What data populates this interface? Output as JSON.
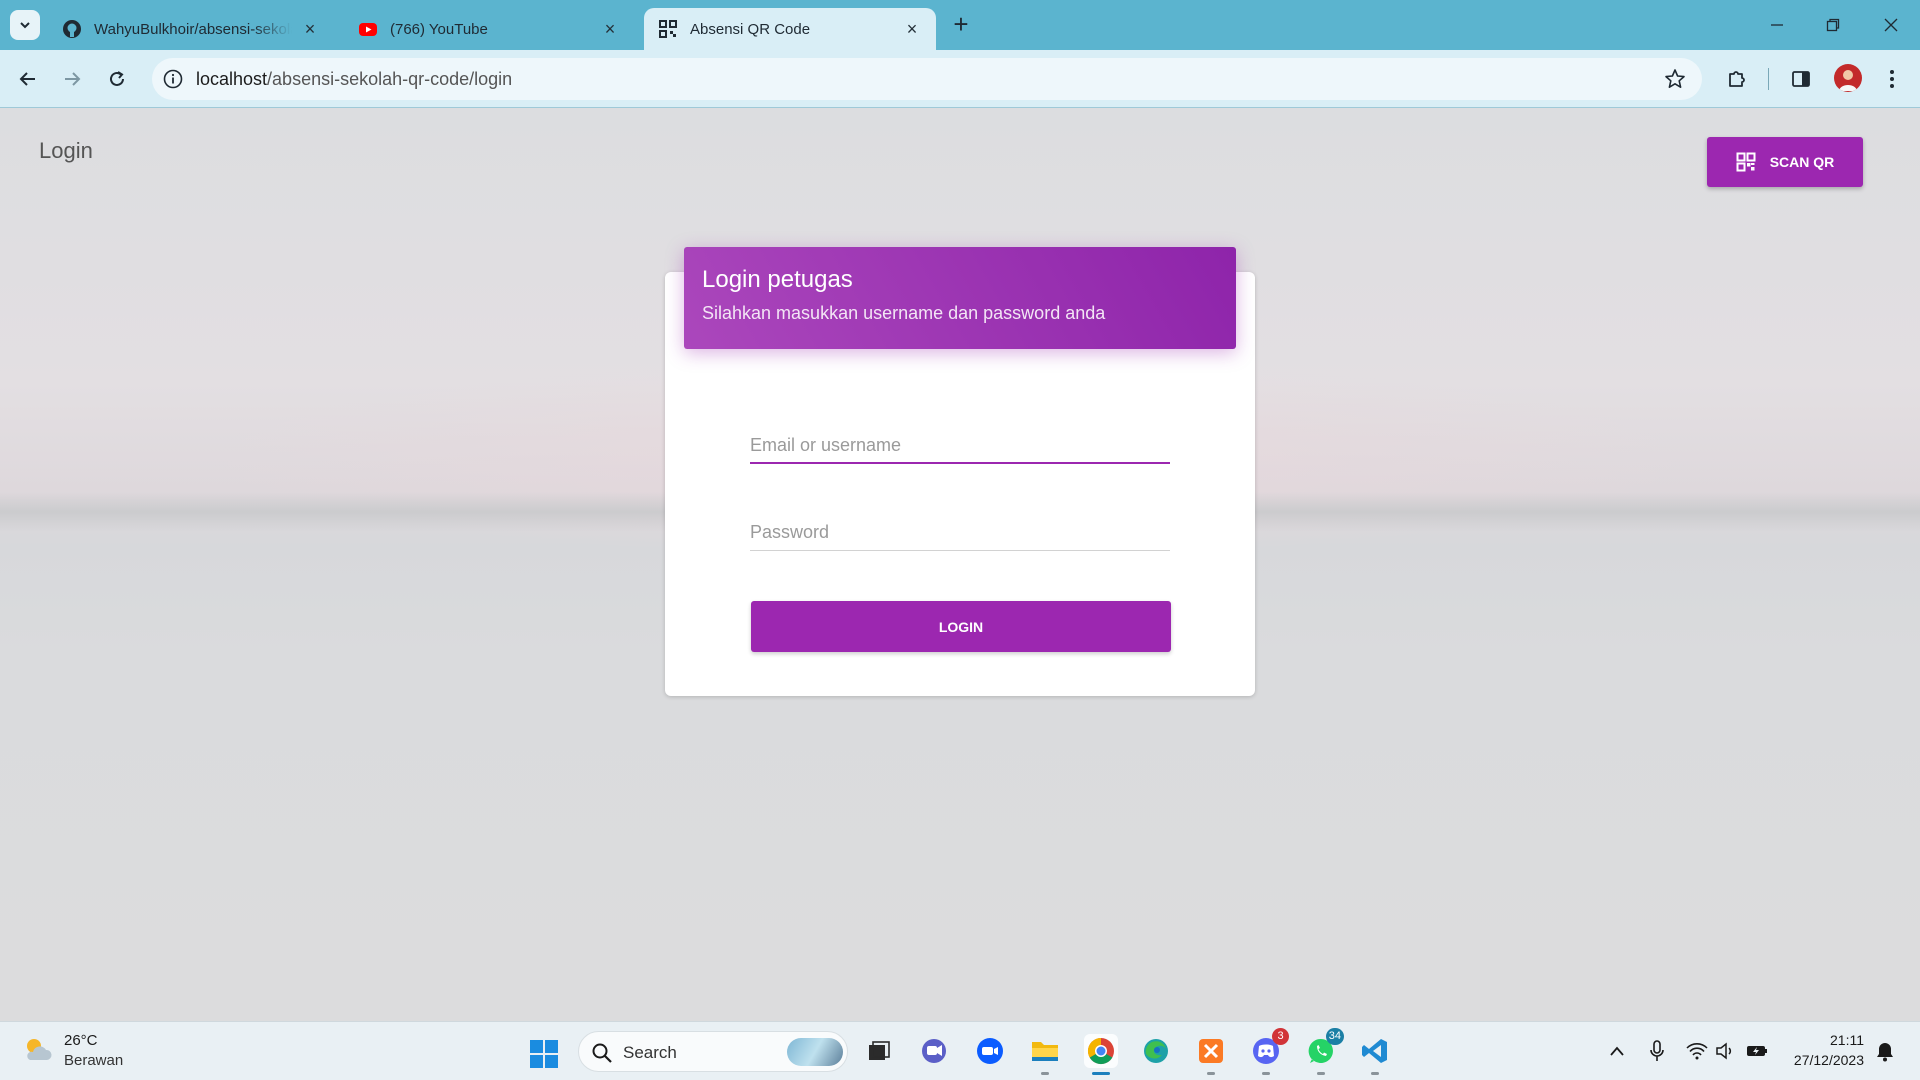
{
  "browser": {
    "tabs": [
      {
        "title": "WahyuBulkhoir/absensi-sekolah-qr-code",
        "icon": "github-icon"
      },
      {
        "title": "(766) YouTube",
        "icon": "youtube-icon"
      },
      {
        "title": "Absensi QR Code",
        "icon": "qr-code-icon",
        "active": true
      }
    ],
    "url_host": "localhost",
    "url_path": "/absensi-sekolah-qr-code/login"
  },
  "page": {
    "title": "Login",
    "scan_button": "SCAN QR",
    "card": {
      "title": "Login petugas",
      "subtitle": "Silahkan masukkan username dan password anda",
      "username_placeholder": "Email or username",
      "username_value": "",
      "password_placeholder": "Password",
      "password_value": "",
      "login_button": "LOGIN"
    }
  },
  "taskbar": {
    "weather": {
      "temp": "26°C",
      "desc": "Berawan"
    },
    "search_placeholder": "Search",
    "apps": [
      {
        "name": "task-view",
        "badge": ""
      },
      {
        "name": "teams-chat",
        "badge": ""
      },
      {
        "name": "zoom",
        "badge": ""
      },
      {
        "name": "file-explorer",
        "badge": ""
      },
      {
        "name": "chrome",
        "badge": "",
        "active": true
      },
      {
        "name": "edge",
        "badge": ""
      },
      {
        "name": "xampp",
        "badge": ""
      },
      {
        "name": "discord",
        "badge": "3"
      },
      {
        "name": "whatsapp",
        "badge": "34"
      },
      {
        "name": "vscode",
        "badge": ""
      }
    ],
    "clock": {
      "time": "21:11",
      "date": "27/12/2023"
    }
  },
  "colors": {
    "accent": "#9c27b0",
    "tabstrip": "#5bb4cf",
    "toolbar": "#d9eef6"
  }
}
